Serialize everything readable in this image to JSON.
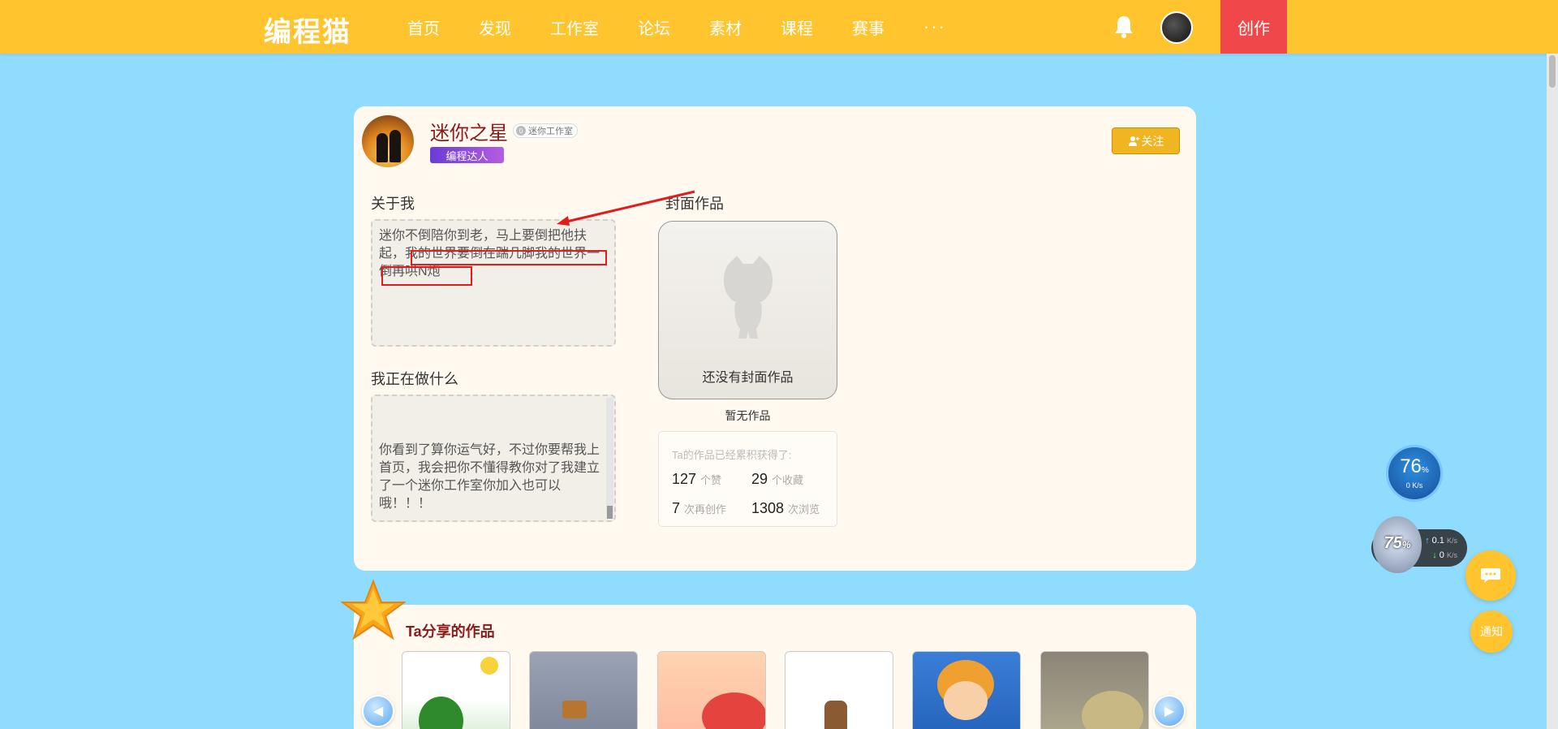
{
  "topbar": {
    "logo": "编程猫",
    "nav": [
      "首页",
      "发现",
      "工作室",
      "论坛",
      "素材",
      "课程",
      "赛事"
    ],
    "more": "···",
    "create": "创作"
  },
  "profile": {
    "name": "迷你之星",
    "studio_tag": "迷你工作室",
    "studio_tag_icon": "0",
    "badge": "编程达人",
    "follow_label": "关注"
  },
  "about": {
    "title": "关于我",
    "text": "迷你不倒陪你到老，马上要倒把他扶起，我的世界要倒在踹几脚我的世界一倒再哄N炮"
  },
  "doing": {
    "title": "我正在做什么",
    "text": "你看到了算你运气好，不过你要帮我上首页，我会把你不懂得教你对了我建立了一个迷你工作室你加入也可以哦！！！"
  },
  "cover": {
    "title": "封面作品",
    "empty_text": "还没有封面作品",
    "no_works": "暂无作品"
  },
  "stats": {
    "title": "Ta的作品已经累积获得了:",
    "items": [
      {
        "value": "127",
        "unit": "个赞"
      },
      {
        "value": "29",
        "unit": "个收藏"
      },
      {
        "value": "7",
        "unit": "次再创作"
      },
      {
        "value": "1308",
        "unit": "次浏览"
      }
    ]
  },
  "works": {
    "title": "Ta分享的作品"
  },
  "widgets": {
    "gauge_value": "76",
    "gauge_unit": "%",
    "gauge_rate": "0 K/s",
    "net_percent": "75",
    "net_percent_unit": "%",
    "net_up": "0.1",
    "net_down": "0",
    "net_unit": "K/s",
    "notify": "通知"
  },
  "colors": {
    "topbar": "#ffc42e",
    "create": "#f0474a",
    "background": "#8fdcff",
    "name": "#8b1a1a",
    "annotation": "#e21b1b"
  }
}
